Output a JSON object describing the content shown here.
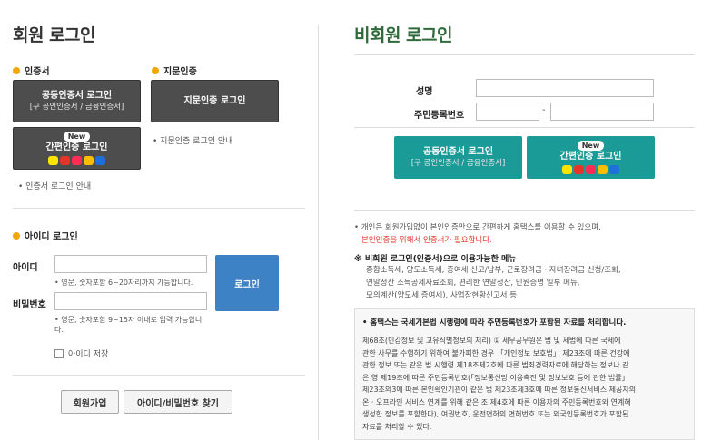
{
  "member": {
    "title": "회원 로그인",
    "cert_head": "인증서",
    "finger_head": "지문인증",
    "joint_cert": {
      "label": "공동인증서 로그인",
      "sub": "[구 공인인증서 / 금융인증서]"
    },
    "finger_btn": "지문인증 로그인",
    "simple_cert": {
      "badge": "New",
      "label": "간편인증 로그인"
    },
    "finger_guide": "• 지문인증 로그인 안내",
    "cert_guide": "• 인증서 로그인 안내",
    "id_head": "아이디 로그인",
    "id_label": "아이디",
    "id_hint": "• 영문, 숫자포함 6~20자리까지 가능합니다.",
    "pw_label": "비밀번호",
    "pw_hint": "• 영문, 숫자포함 9~15자 이내로 입력 가능합니다.",
    "login_btn": "로그인",
    "save_id": "아이디 저장",
    "join_btn": "회원가입",
    "find_btn": "아이디/비밀번호 찾기"
  },
  "guest": {
    "title": "비회원 로그인",
    "name_label": "성명",
    "rrn_label": "주민등록번호",
    "rrn_dash": "-",
    "joint_cert": {
      "label": "공동인증서 로그인",
      "sub": "[구 공인인증서 / 금융인증서]"
    },
    "simple_cert": {
      "badge": "New",
      "label": "간편인증 로그인"
    },
    "notice1": "• 개인은 회원가입없이 본인인증만으로 간편하게 홈택스를 이용할 수 있으며,",
    "notice1_red": "본인인증을 위해서 인증서가 필요합니다.",
    "menu_head": "※ 비회원 로그인(인증서)으로 이용가능한 메뉴",
    "menu_lines": [
      "종합소득세, 양도소득세, 증여세 신고/납부, 근로장려금 · 자녀장려금 신청/조회,",
      "연말정산 소득공제자료조회, 편리한 연말정산, 민원증명 일부 메뉴,",
      "모의계산(양도세,증여세), 사업장현황신고서 등"
    ],
    "box_head": "• 홈택스는 국세기본법 시행령에 따라 주민등록번호가 포함된 자료를 처리합니다.",
    "box_lines": [
      "제68조(민감정보 및 고유식별정보의 처리) ① 세무공무원은 법 및 세법에 따른 국세에",
      "관한 사무를 수행하기 위하여 불가피한 경우 「개인정보 보호법」 제23조에 따른 건강에",
      "관한 정보 또는 같은 법 시행령 제18조제2호에 따른 범죄경력자료에 해당하는 정보나 같",
      "은 영 제19조에 따른 주민등록번호(「정보통신망 이용촉진 및 정보보호 등에 관한 법률」",
      "제23조의3에 따른 본인확인기관이 같은 법 제23조제3호에 따른 정보통신서비스 제공자의",
      "온 · 오프라인 서비스 연계를 위해 같은 조 제4호에 따른 이용자의 주민등록번호와 연계해",
      "생성한 정보를 포함한다), 여권번호, 운전면허의 면허번호 또는 외국인등록번호가 포함된",
      "자료를 처리할 수 있다."
    ]
  },
  "colors": {
    "accent": "#f2a600",
    "teal": "#1a9b97",
    "blue": "#3d82c4",
    "green_title": "#2f6b3a",
    "red": "#e4352a"
  },
  "icons": [
    "kakao-icon",
    "pass-icon",
    "payco-icon",
    "kb-icon",
    "naver-icon"
  ]
}
